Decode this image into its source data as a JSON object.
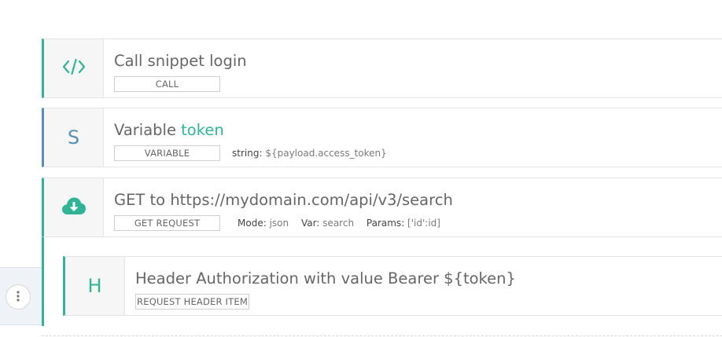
{
  "steps": [
    {
      "icon": "code-icon",
      "title": "Call snippet login",
      "type_label": "CALL",
      "accent": "#2fb595"
    },
    {
      "icon": "letter-s-icon",
      "letter": "S",
      "title_prefix": "Variable ",
      "title_highlight": "token",
      "type_label": "VARIABLE",
      "meta": {
        "string_key": "string:",
        "string_value": "${payload.access_token}"
      },
      "accent": "#5b8fb5"
    },
    {
      "icon": "cloud-download-icon",
      "title": "GET to https://mydomain.com/api/v3/search",
      "type_label": "GET REQUEST",
      "meta": {
        "mode_key": "Mode:",
        "mode_value": "json",
        "var_key": "Var:",
        "var_value": "search",
        "params_key": "Params:",
        "params_value": "['id':id]"
      },
      "accent": "#2fb595"
    },
    {
      "icon": "letter-h-icon",
      "letter": "H",
      "title": "Header Authorization with value Bearer ${token}",
      "type_label": "REQUEST HEADER ITEM",
      "accent": "#2fb595"
    }
  ],
  "handle_icon": "vertical-dots-icon"
}
